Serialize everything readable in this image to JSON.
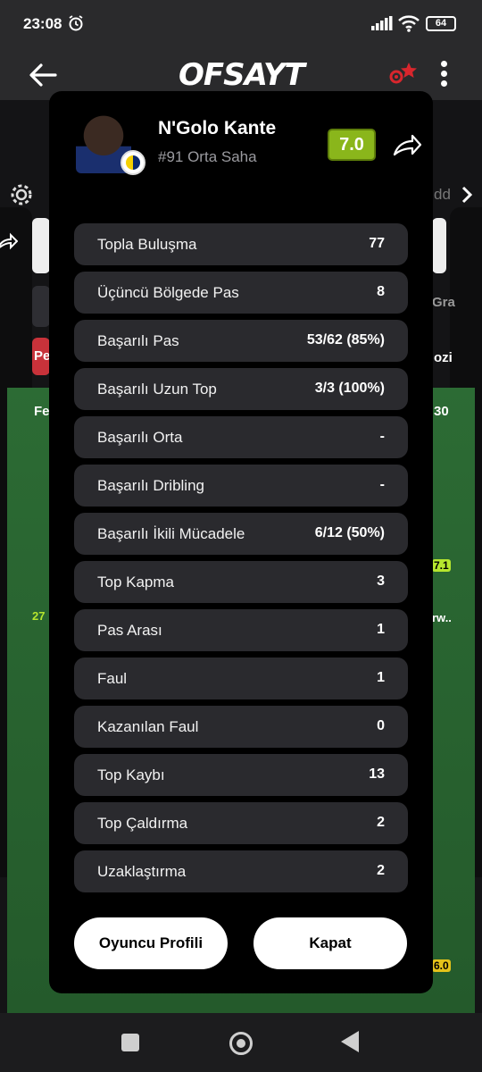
{
  "status_bar": {
    "time": "23:08",
    "battery": "64"
  },
  "app": {
    "logo": "OFSAYT"
  },
  "background": {
    "left_text_1": "Pe",
    "left_text_2": "Fe",
    "left_text_3": "27",
    "right_text_1": "dd",
    "right_text_2": "Gra",
    "right_text_3": "ozi",
    "right_text_4": "30",
    "right_text_5": "7.1",
    "right_text_6": "rw..",
    "right_text_7": "6.0"
  },
  "player": {
    "name": "N'Golo Kante",
    "info": "#91 Orta Saha",
    "rating": "7.0"
  },
  "stats": [
    {
      "label": "Topla Buluşma",
      "value": "77"
    },
    {
      "label": "Üçüncü Bölgede Pas",
      "value": "8"
    },
    {
      "label": "Başarılı Pas",
      "value": "53/62 (85%)"
    },
    {
      "label": "Başarılı Uzun Top",
      "value": "3/3 (100%)"
    },
    {
      "label": "Başarılı Orta",
      "value": "-"
    },
    {
      "label": "Başarılı Dribling",
      "value": "-"
    },
    {
      "label": "Başarılı İkili Mücadele",
      "value": "6/12 (50%)"
    },
    {
      "label": "Top Kapma",
      "value": "3"
    },
    {
      "label": "Pas Arası",
      "value": "1"
    },
    {
      "label": "Faul",
      "value": "1"
    },
    {
      "label": "Kazanılan Faul",
      "value": "0"
    },
    {
      "label": "Top Kaybı",
      "value": "13"
    },
    {
      "label": "Top Çaldırma",
      "value": "2"
    },
    {
      "label": "Uzaklaştırma",
      "value": "2"
    }
  ],
  "buttons": {
    "profile": "Oyuncu Profili",
    "close": "Kapat"
  },
  "colors": {
    "rating_bg": "#8ab61b",
    "modal_bg": "#000000",
    "row_bg": "#2a2a2e",
    "field_green": "#2c6b34"
  }
}
